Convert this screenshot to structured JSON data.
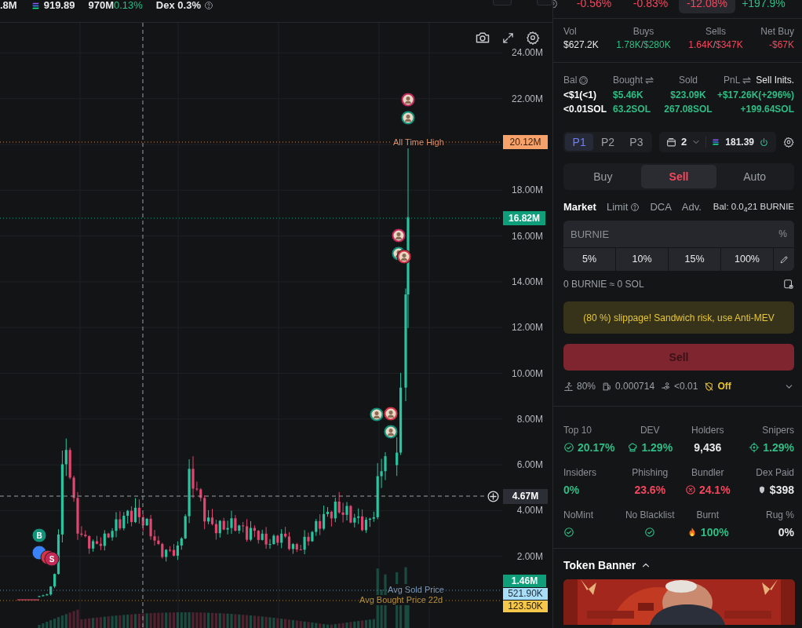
{
  "top_bar": {
    "items": [
      {
        "kind": "value",
        "text": ".8M"
      },
      {
        "kind": "sol",
        "text": "919.89"
      },
      {
        "kind": "change",
        "text": "970M",
        "change": "0.13%"
      },
      {
        "kind": "help",
        "text": "Dex 0.3%"
      }
    ]
  },
  "chart": {
    "y_ticks": [
      "24.00M",
      "22.00M",
      "18.00M",
      "16.00M",
      "14.00M",
      "12.00M",
      "10.00M",
      "8.00M",
      "6.00M",
      "4.00M",
      "2.00M"
    ],
    "all_time_high": {
      "label": "All Time High",
      "value": "20.12M"
    },
    "current_price": "16.82M",
    "crosshair_price": "4.67M",
    "volume_price": "1.46M",
    "avg_sold": {
      "label": "Avg Sold Price",
      "value": "521.90K"
    },
    "avg_bought": {
      "label": "Avg Bought Price 22d",
      "value": "123.50K"
    },
    "markers": [
      {
        "kind": "letter",
        "text": "B",
        "color": "#12937a"
      },
      {
        "kind": "plain",
        "color": "#3b82f6"
      },
      {
        "kind": "plain",
        "color": "#d63346"
      },
      {
        "kind": "letter",
        "text": "S",
        "color": "#c22a55"
      },
      {
        "kind": "avatar",
        "color": "#c2285a"
      },
      {
        "kind": "avatar",
        "color": "#12937a"
      },
      {
        "kind": "avatar",
        "color": "#c2285a"
      },
      {
        "kind": "avatar",
        "color": "#12937a"
      },
      {
        "kind": "avatar",
        "color": "#d63346"
      },
      {
        "kind": "avatar",
        "color": "#12937a"
      },
      {
        "kind": "avatar",
        "color": "#d63346"
      },
      {
        "kind": "avatar",
        "color": "#12937a"
      }
    ]
  },
  "timeframe_changes": [
    {
      "text": "-0.56%",
      "selected": false
    },
    {
      "text": "-0.83%",
      "selected": false
    },
    {
      "text": "-12.08%",
      "selected": true
    },
    {
      "text": "+197.9%",
      "selected": false
    }
  ],
  "flow": [
    {
      "label": "Vol",
      "parts": [
        "$627.2K"
      ]
    },
    {
      "label": "Buys",
      "parts": [
        "1.78K",
        "/",
        "$280K"
      ]
    },
    {
      "label": "Sells",
      "parts": [
        "1.64K",
        "/",
        "$347K"
      ]
    },
    {
      "label": "Net Buy",
      "parts": [
        "-$67K"
      ]
    }
  ],
  "position": {
    "headers": [
      {
        "label": "Bal"
      },
      {
        "label": "Bought"
      },
      {
        "label": "Sold"
      },
      {
        "label": "PnL",
        "extra": "Sell Inits."
      }
    ],
    "rows": [
      [
        "<$1(<1)",
        "$5.46K",
        "$23.09K",
        "+$17.26K(+296%)"
      ],
      [
        "<0.01SOL",
        "63.2SOL",
        "267.08SOL",
        "+199.64SOL"
      ]
    ]
  },
  "presets": [
    {
      "label": "P1",
      "selected": true
    },
    {
      "label": "P2",
      "selected": false
    },
    {
      "label": "P3",
      "selected": false
    }
  ],
  "wallet": {
    "count": "2",
    "balance": "181.39"
  },
  "trade_tabs": [
    {
      "label": "Buy",
      "selected": false
    },
    {
      "label": "Sell",
      "selected": true
    },
    {
      "label": "Auto",
      "selected": false
    }
  ],
  "order_types": [
    {
      "label": "Market",
      "selected": true,
      "help": false
    },
    {
      "label": "Limit",
      "selected": false,
      "help": true
    },
    {
      "label": "DCA",
      "selected": false,
      "help": false
    },
    {
      "label": "Adv.",
      "selected": false,
      "help": false
    }
  ],
  "balance": "Bal: 0.0$_{4}$21 BURNIE",
  "amount_field": {
    "placeholder": "BURNIE",
    "unit": "%"
  },
  "quick_amounts": [
    "5%",
    "10%",
    "15%",
    "100%"
  ],
  "estimate": "0 BURNIE ≈ 0 SOL",
  "warning": "(80 %) slippage! Sandwich risk, use Anti-MEV",
  "submit": "Sell",
  "settings": [
    "80%",
    "0.000714",
    "<0.01",
    "Off"
  ],
  "stats": [
    {
      "label": "Top 10",
      "value": "20.17%"
    },
    {
      "label": "DEV",
      "value": "1.29%"
    },
    {
      "label": "Holders",
      "value": "9,436"
    },
    {
      "label": "Snipers",
      "value": "1.29%"
    },
    {
      "label": "Insiders",
      "value": "0%"
    },
    {
      "label": "Phishing",
      "value": "23.6%"
    },
    {
      "label": "Bundler",
      "value": "24.1%"
    },
    {
      "label": "Dex Paid",
      "value": "$398"
    },
    {
      "label": "NoMint"
    },
    {
      "label": "No Blacklist"
    },
    {
      "label": "Burnt",
      "value": "100%"
    },
    {
      "label": "Rug %",
      "value": "0%"
    }
  ],
  "banner": {
    "title": "Token Banner",
    "expanded": true,
    "kind": "picture"
  }
}
